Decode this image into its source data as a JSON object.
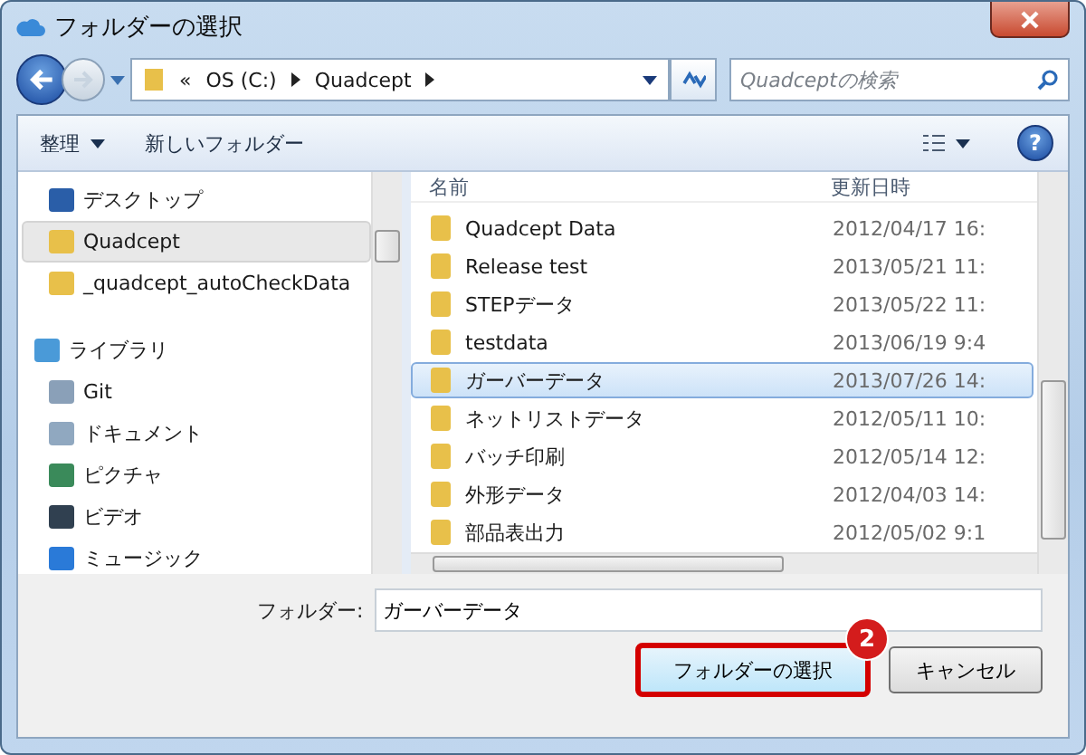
{
  "window": {
    "title": "フォルダーの選択"
  },
  "address_bar": {
    "segments": [
      "«",
      "OS (C:)",
      "Quadcept"
    ]
  },
  "search": {
    "placeholder": "Quadceptの検索"
  },
  "toolbar": {
    "organize": "整理",
    "new_folder": "新しいフォルダー",
    "help": "?"
  },
  "nav_pane": {
    "items": [
      {
        "label": "デスクトップ",
        "kind": "desktop",
        "selected": false
      },
      {
        "label": "Quadcept",
        "kind": "folder",
        "selected": true
      },
      {
        "label": "_quadcept_autoCheckData",
        "kind": "folder",
        "selected": false
      }
    ],
    "library": {
      "label": "ライブラリ",
      "kind": "library",
      "children": [
        {
          "label": "Git",
          "kind": "git",
          "selected": false
        },
        {
          "label": "ドキュメント",
          "kind": "document",
          "selected": false
        },
        {
          "label": "ピクチャ",
          "kind": "picture",
          "selected": false
        },
        {
          "label": "ビデオ",
          "kind": "video",
          "selected": false
        },
        {
          "label": "ミュージック",
          "kind": "music",
          "selected": false
        }
      ]
    }
  },
  "file_list": {
    "columns": [
      "名前",
      "更新日時"
    ],
    "rows": [
      {
        "name": "Quadcept Data",
        "modified": "2012/04/17 16:",
        "selected": false
      },
      {
        "name": "Release test",
        "modified": "2013/05/21 11:",
        "selected": false
      },
      {
        "name": "STEPデータ",
        "modified": "2013/05/22 11:",
        "selected": false
      },
      {
        "name": "testdata",
        "modified": "2013/06/19 9:4",
        "selected": false
      },
      {
        "name": "ガーバーデータ",
        "modified": "2013/07/26 14:",
        "selected": true
      },
      {
        "name": "ネットリストデータ",
        "modified": "2012/05/11 10:",
        "selected": false
      },
      {
        "name": "バッチ印刷",
        "modified": "2012/05/14 12:",
        "selected": false
      },
      {
        "name": "外形データ",
        "modified": "2012/04/03 14:",
        "selected": false
      },
      {
        "name": "部品表出力",
        "modified": "2012/05/02 9:1",
        "selected": false
      }
    ]
  },
  "folder_field": {
    "label": "フォルダー:",
    "value": "ガーバーデータ"
  },
  "buttons": [
    {
      "label": "フォルダーの選択",
      "highlighted": true,
      "callout": "2"
    },
    {
      "label": "キャンセル",
      "highlighted": false
    }
  ]
}
